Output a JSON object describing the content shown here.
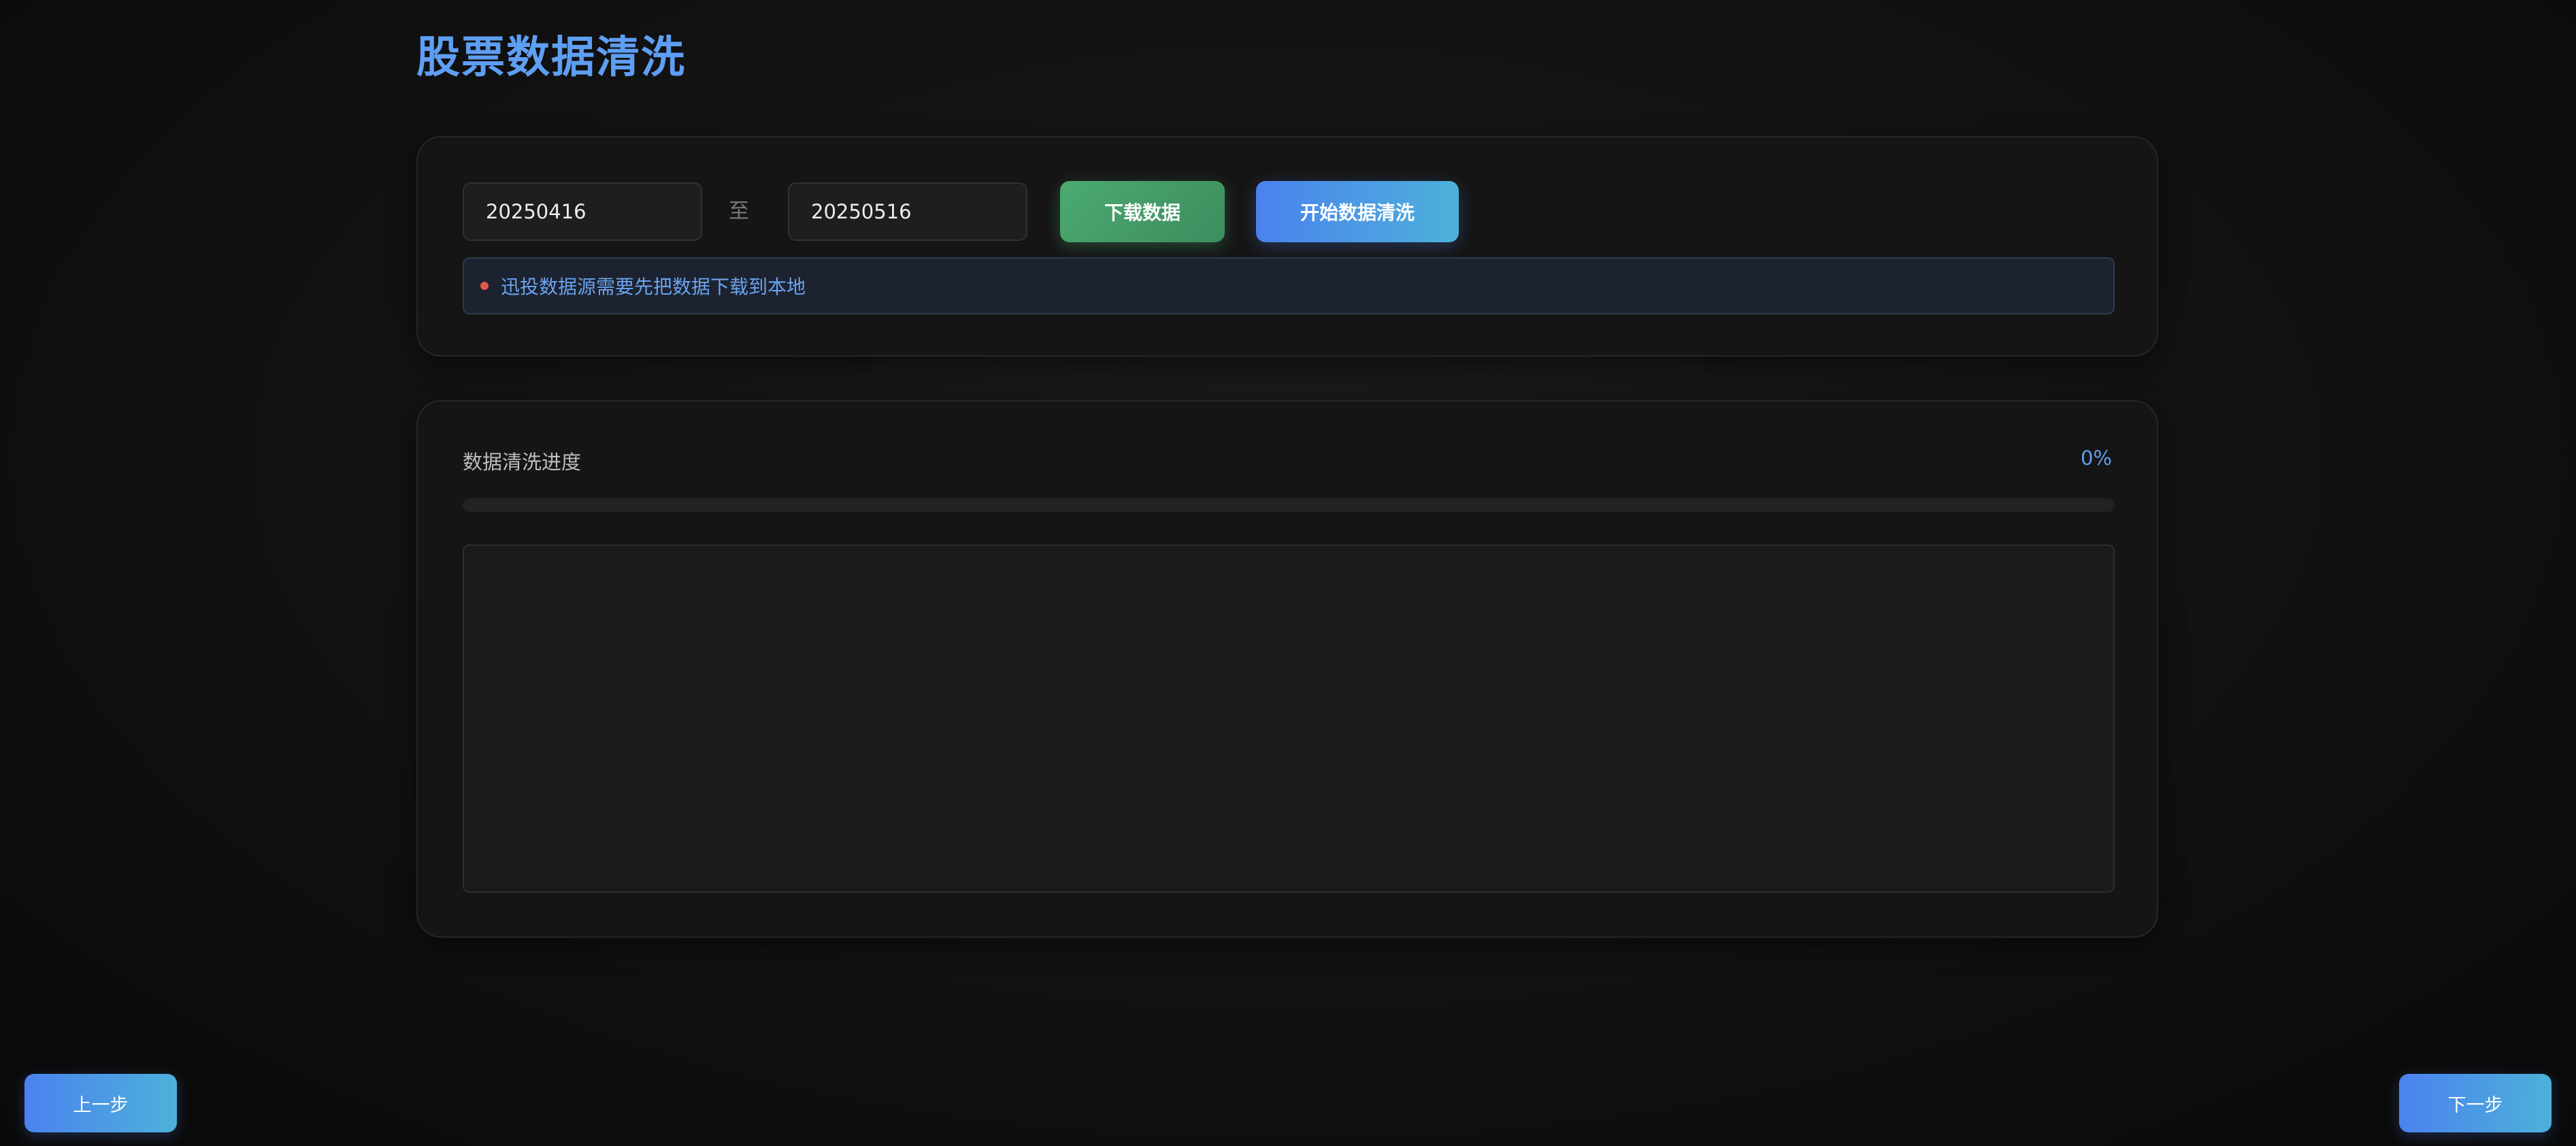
{
  "page": {
    "title": "股票数据清洗"
  },
  "controls": {
    "start_date": "20250416",
    "range_separator": "至",
    "end_date": "20250516",
    "download_label": "下载数据",
    "start_clean_label": "开始数据清洗",
    "notice": "迅投数据源需要先把数据下载到本地"
  },
  "progress": {
    "label": "数据清洗进度",
    "percent_text": "0%",
    "value_percent": 0
  },
  "log": {
    "content": ""
  },
  "navigation": {
    "prev_label": "上一步",
    "next_label": "下一步"
  },
  "colors": {
    "accent": "#5e9ef3",
    "download_button": "#4caa72",
    "notice_dot": "#e2584a",
    "background": "#111111"
  }
}
